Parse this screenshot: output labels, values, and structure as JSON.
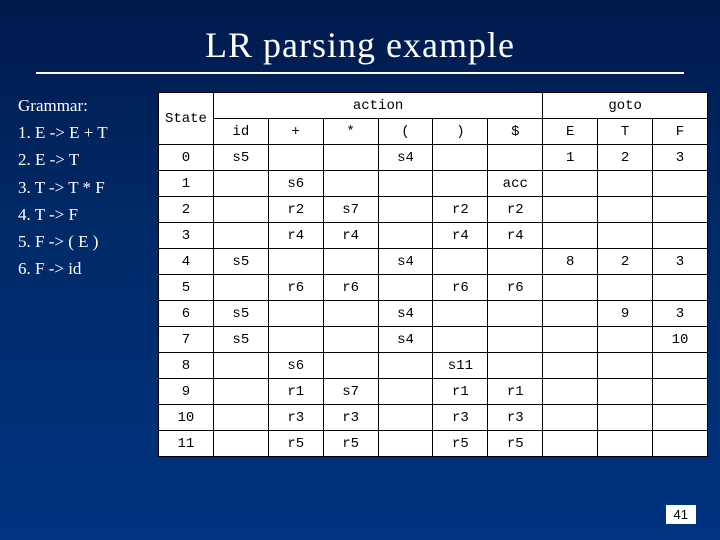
{
  "title": "LR parsing example",
  "grammar": {
    "heading": "Grammar:",
    "rules": [
      "1. E -> E + T",
      "2. E -> T",
      "3. T -> T * F",
      "4. T -> F",
      "5. F -> ( E )",
      "6. F -> id"
    ]
  },
  "table": {
    "group_state": "State",
    "group_action": "action",
    "group_goto": "goto",
    "action_cols": [
      "id",
      "+",
      "*",
      "(",
      ")",
      "$"
    ],
    "goto_cols": [
      "E",
      "T",
      "F"
    ],
    "rows": [
      {
        "state": "0",
        "action": [
          "s5",
          "",
          "",
          "s4",
          "",
          ""
        ],
        "goto": [
          "1",
          "2",
          "3"
        ]
      },
      {
        "state": "1",
        "action": [
          "",
          "s6",
          "",
          "",
          "",
          "acc"
        ],
        "goto": [
          "",
          "",
          ""
        ]
      },
      {
        "state": "2",
        "action": [
          "",
          "r2",
          "s7",
          "",
          "r2",
          "r2"
        ],
        "goto": [
          "",
          "",
          ""
        ]
      },
      {
        "state": "3",
        "action": [
          "",
          "r4",
          "r4",
          "",
          "r4",
          "r4"
        ],
        "goto": [
          "",
          "",
          ""
        ]
      },
      {
        "state": "4",
        "action": [
          "s5",
          "",
          "",
          "s4",
          "",
          ""
        ],
        "goto": [
          "8",
          "2",
          "3"
        ]
      },
      {
        "state": "5",
        "action": [
          "",
          "r6",
          "r6",
          "",
          "r6",
          "r6"
        ],
        "goto": [
          "",
          "",
          ""
        ]
      },
      {
        "state": "6",
        "action": [
          "s5",
          "",
          "",
          "s4",
          "",
          ""
        ],
        "goto": [
          "",
          "9",
          "3"
        ]
      },
      {
        "state": "7",
        "action": [
          "s5",
          "",
          "",
          "s4",
          "",
          ""
        ],
        "goto": [
          "",
          "",
          "10"
        ]
      },
      {
        "state": "8",
        "action": [
          "",
          "s6",
          "",
          "",
          "s11",
          ""
        ],
        "goto": [
          "",
          "",
          ""
        ]
      },
      {
        "state": "9",
        "action": [
          "",
          "r1",
          "s7",
          "",
          "r1",
          "r1"
        ],
        "goto": [
          "",
          "",
          ""
        ]
      },
      {
        "state": "10",
        "action": [
          "",
          "r3",
          "r3",
          "",
          "r3",
          "r3"
        ],
        "goto": [
          "",
          "",
          ""
        ]
      },
      {
        "state": "11",
        "action": [
          "",
          "r5",
          "r5",
          "",
          "r5",
          "r5"
        ],
        "goto": [
          "",
          "",
          ""
        ]
      }
    ]
  },
  "page_number": "41"
}
